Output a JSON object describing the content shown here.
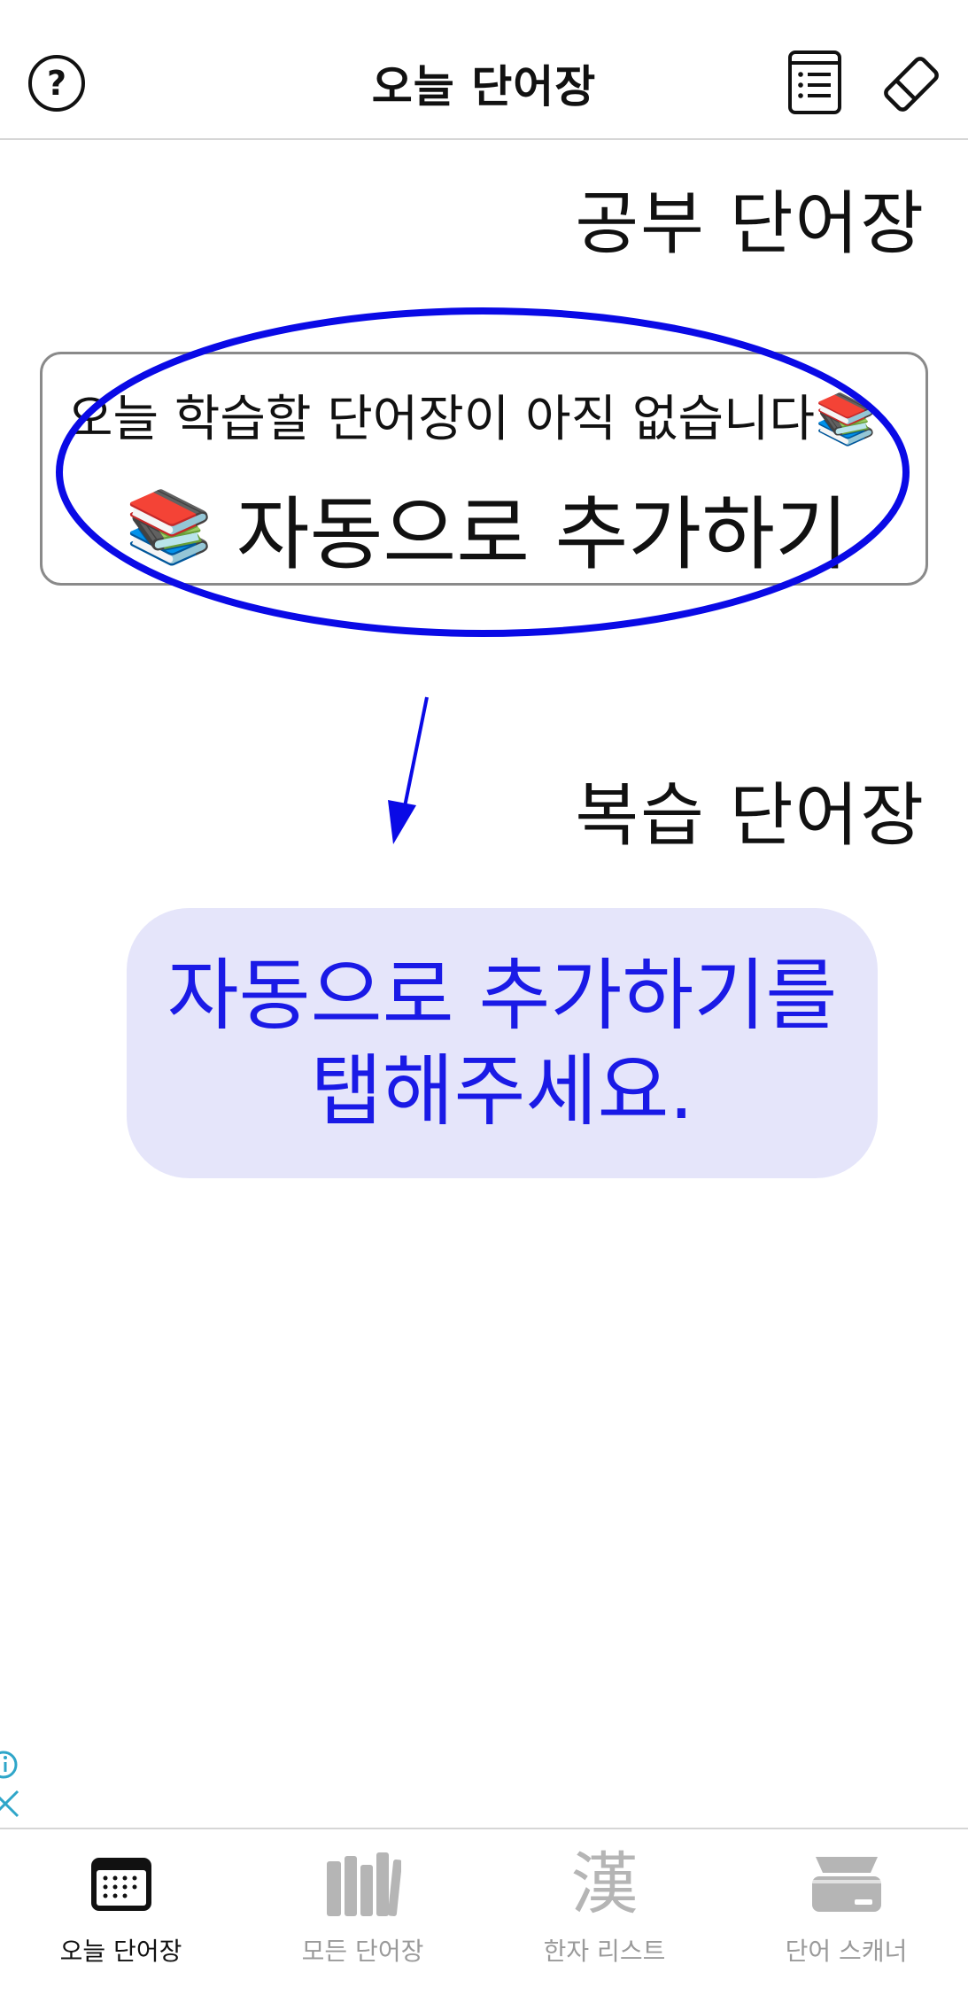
{
  "header": {
    "title": "오늘 단어장",
    "help_icon": "question-circle-icon",
    "list_icon": "list-document-icon",
    "eraser_icon": "eraser-icon"
  },
  "study_section": {
    "title": "공부 단어장",
    "empty_message": "오늘 학습할 단어장이 아직 없습니다",
    "empty_emoji": "📚",
    "auto_add_emoji": "📚",
    "auto_add_label": "자동으로 추가하기"
  },
  "review_section": {
    "title": "복습 단어장"
  },
  "hint": {
    "line1": "자동으로 추가하기를",
    "line2": "탭해주세요."
  },
  "colors": {
    "highlight": "#0a0ae6",
    "hint_bg": "#e5e5fa",
    "hint_text": "#1a1ae6",
    "ad_icon": "#2fa6c9"
  },
  "tabs": [
    {
      "label": "오늘 단어장",
      "icon": "calendar-icon",
      "active": true
    },
    {
      "label": "모든 단어장",
      "icon": "books-icon",
      "active": false
    },
    {
      "label": "한자 리스트",
      "icon": "hanja-icon",
      "glyph": "漢",
      "active": false
    },
    {
      "label": "단어 스캐너",
      "icon": "scanner-icon",
      "active": false
    }
  ]
}
